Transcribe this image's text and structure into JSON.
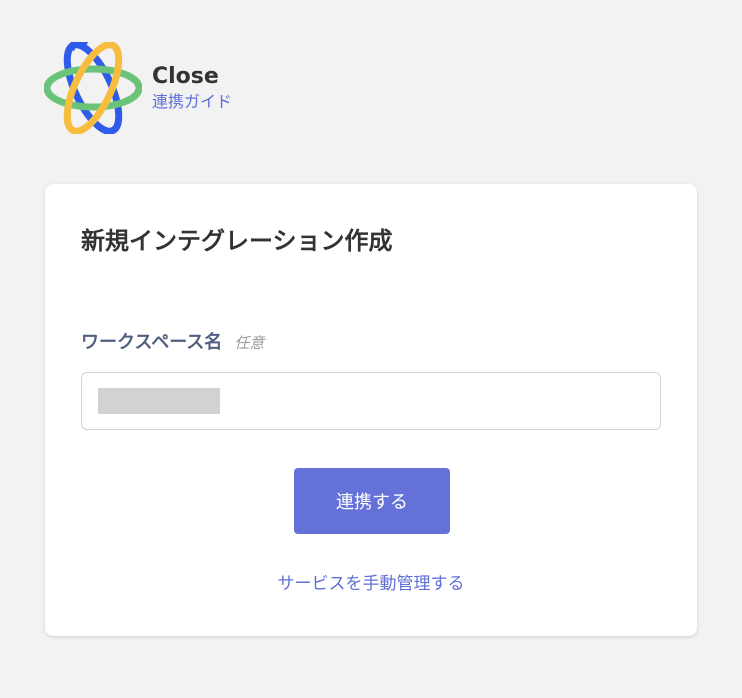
{
  "brand": {
    "name": "Close",
    "guide_link": "連携ガイド",
    "logo_colors": {
      "blue": "#2f5bea",
      "yellow": "#f7bd3f",
      "green": "#6bc37a"
    }
  },
  "form": {
    "title": "新規インテグレーション作成",
    "workspace_label": "ワークスペース名",
    "optional_tag": "任意",
    "workspace_value_redacted": true,
    "submit_label": "連携する",
    "manual_link": "サービスを手動管理する"
  },
  "colors": {
    "accent": "#6471d9",
    "link": "#5f6fd8",
    "label": "#51607f",
    "page_background": "#f2f2f2"
  }
}
